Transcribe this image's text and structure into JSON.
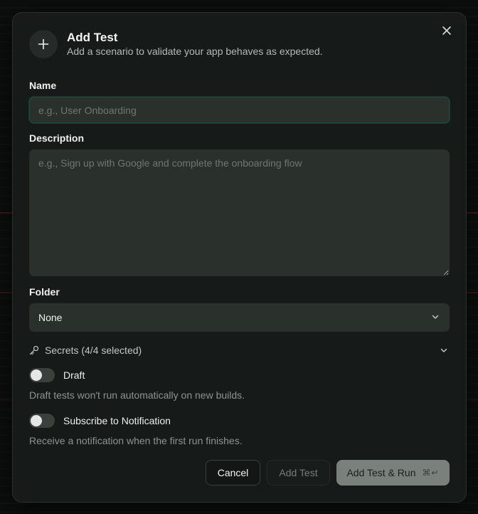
{
  "modal": {
    "title": "Add Test",
    "subtitle": "Add a scenario to validate your app behaves as expected.",
    "header_icon": "plus-icon",
    "close_icon": "close-icon"
  },
  "form": {
    "name": {
      "label": "Name",
      "value": "",
      "placeholder": "e.g., User Onboarding"
    },
    "description": {
      "label": "Description",
      "value": "",
      "placeholder": "e.g., Sign up with Google and complete the onboarding flow"
    },
    "folder": {
      "label": "Folder",
      "selected": "None"
    },
    "secrets": {
      "label": "Secrets (4/4 selected)",
      "icon": "key-icon"
    },
    "draft": {
      "label": "Draft",
      "enabled": false,
      "helper": "Draft tests won't run automatically on new builds."
    },
    "subscribe": {
      "label": "Subscribe to Notification",
      "enabled": false,
      "helper": "Receive a notification when the first run finishes."
    }
  },
  "actions": {
    "cancel_label": "Cancel",
    "add_label": "Add Test",
    "add_run_label": "Add Test & Run",
    "add_run_shortcut": "⌘↵"
  },
  "colors": {
    "accent_focus": "#1e4a3e",
    "surface": "#161a18",
    "field": "#2a312d"
  }
}
